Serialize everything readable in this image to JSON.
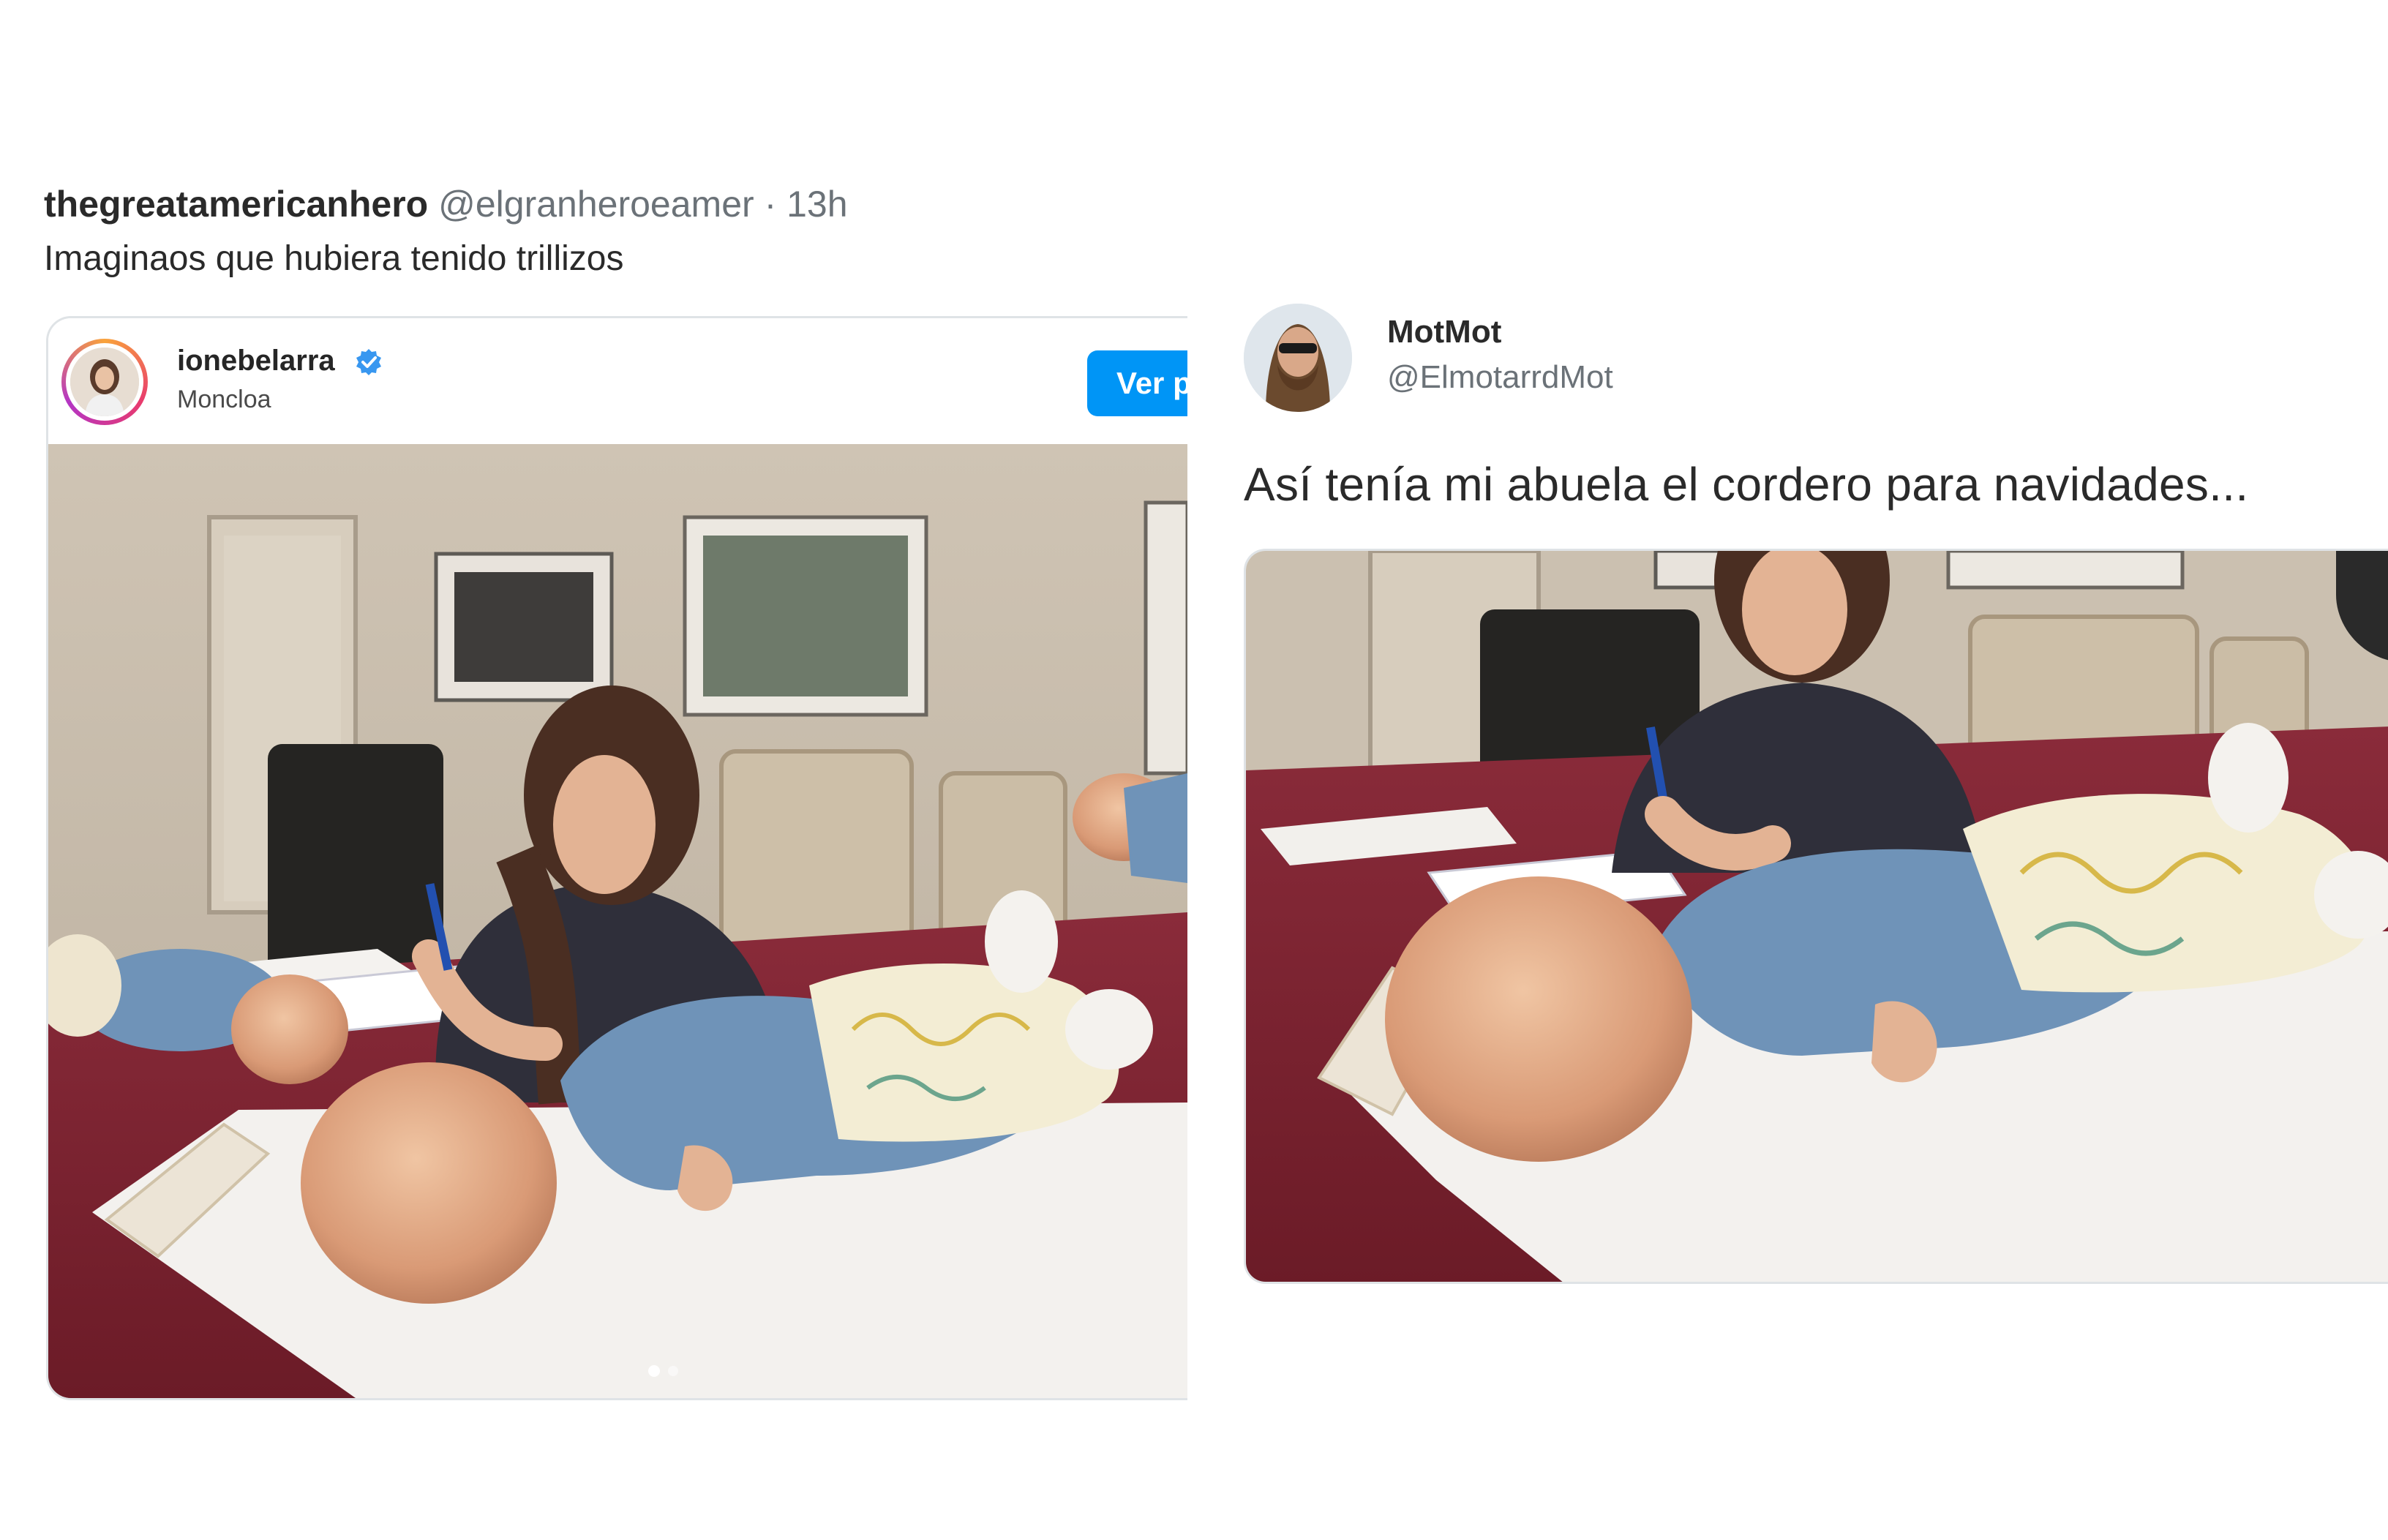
{
  "left_tweet": {
    "author_name": "thegreatamericanhero",
    "author_handle": "@elgranheroeamer",
    "separator": "·",
    "timestamp": "13h",
    "text": "Imaginaos que hubiera tenido trillizos",
    "embedded_post": {
      "platform": "instagram",
      "username": "ionebelarra",
      "verified": true,
      "location": "Moncloa",
      "follow_button_label": "Ver p",
      "carousel": {
        "total": 2,
        "active": 1
      }
    }
  },
  "right_tweet": {
    "author_name": "MotMot",
    "author_handle": "@ElmotarrdMot",
    "text": "Así tenía mi abuela el cordero para navidades..."
  },
  "colors": {
    "accent_blue": "#0095f6",
    "verified_blue": "#3897f0",
    "tablecloth": "#7a1f2e",
    "baby_sweater": "#6f93b8"
  },
  "icons": {
    "verified": "verified-badge-icon",
    "dot": "carousel-dot-icon"
  }
}
